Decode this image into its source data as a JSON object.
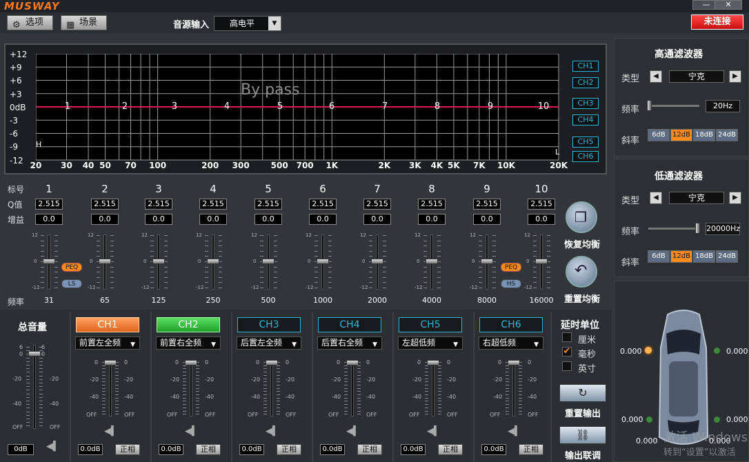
{
  "app": {
    "logo": "MUSWAY"
  },
  "window": {
    "minimize": "—",
    "close": "✕"
  },
  "toolbar": {
    "options_label": "选项",
    "scene_label": "场景",
    "source_label": "音源输入",
    "source_value": "高电平",
    "connection_label": "未连接"
  },
  "eq_graph": {
    "y_labels": [
      "+12",
      "+9",
      "+6",
      "+3",
      "0dB",
      "-3",
      "-6",
      "-9",
      "-12"
    ],
    "x_labels": [
      "20",
      "30",
      "40",
      "50",
      "70",
      "100",
      "200",
      "300",
      "500",
      "700",
      "1K",
      "2K",
      "3K",
      "4K",
      "5K",
      "7K",
      "10K",
      "20K"
    ],
    "bypass_text": "By pass",
    "band_markers": [
      "1",
      "2",
      "3",
      "4",
      "5",
      "6",
      "7",
      "8",
      "9",
      "10"
    ],
    "high_marker": "H",
    "low_marker": "L",
    "channel_buttons": [
      "CH1",
      "CH2",
      "CH3",
      "CH4",
      "CH5",
      "CH6"
    ]
  },
  "eq_bands": {
    "row_labels": {
      "index": "标号",
      "q": "Q值",
      "gain": "增益",
      "freq": "频率"
    },
    "scale": {
      "top": "12",
      "mid": "0",
      "bottom": "-12"
    },
    "bands": [
      {
        "id": "1",
        "q": "2.515",
        "gain": "0.0",
        "freq": "31",
        "level": 0
      },
      {
        "id": "2",
        "q": "2.515",
        "gain": "0.0",
        "freq": "65",
        "level": 0
      },
      {
        "id": "3",
        "q": "2.515",
        "gain": "0.0",
        "freq": "125",
        "level": 0
      },
      {
        "id": "4",
        "q": "2.515",
        "gain": "0.0",
        "freq": "250",
        "level": 0
      },
      {
        "id": "5",
        "q": "2.515",
        "gain": "0.0",
        "freq": "500",
        "level": 0
      },
      {
        "id": "6",
        "q": "2.515",
        "gain": "0.0",
        "freq": "1000",
        "level": 0
      },
      {
        "id": "7",
        "q": "2.515",
        "gain": "0.0",
        "freq": "2000",
        "level": 0
      },
      {
        "id": "8",
        "q": "2.515",
        "gain": "0.0",
        "freq": "4000",
        "level": 0
      },
      {
        "id": "9",
        "q": "2.515",
        "gain": "0.0",
        "freq": "8000",
        "level": 0
      },
      {
        "id": "10",
        "q": "2.515",
        "gain": "0.0",
        "freq": "16000",
        "level": 0
      }
    ],
    "band1_pills": {
      "peq": "PEQ",
      "shelf": "LS"
    },
    "band9_pills": {
      "peq": "PEQ",
      "shelf": "HS"
    },
    "restore_label": "恢复均衡",
    "reset_label": "重置均衡"
  },
  "colors": {
    "accent_orange": "#ff8a1a",
    "green": "#29c93a",
    "cyan": "#27b7d8",
    "connect_red": "#e81d1d",
    "curve": "#e3135a"
  },
  "highpass": {
    "title": "高通滤波器",
    "type_label": "类型",
    "type_value": "宁克",
    "freq_label": "频率",
    "freq_value": "20Hz",
    "slope_label": "斜率",
    "slopes": [
      "6dB",
      "12dB",
      "18dB",
      "24dB"
    ],
    "slope_selected": "12dB",
    "level": 0.0
  },
  "lowpass": {
    "title": "低通滤波器",
    "type_label": "类型",
    "type_value": "宁克",
    "freq_label": "频率",
    "freq_value": "20000Hz",
    "slope_label": "斜率",
    "slopes": [
      "6dB",
      "12dB",
      "18dB",
      "24dB"
    ],
    "slope_selected": "12dB",
    "level": 1.0
  },
  "master": {
    "title": "总音量",
    "scale": [
      "6",
      "0",
      "-20",
      "-40",
      "OFF"
    ],
    "value": "0dB"
  },
  "channels": [
    {
      "name": "CH1",
      "state": "orange",
      "position": "前置左全频",
      "db": "0.0dB",
      "phase": "正相"
    },
    {
      "name": "CH2",
      "state": "green",
      "position": "前置右全频",
      "db": "0.0dB",
      "phase": "正相"
    },
    {
      "name": "CH3",
      "state": "outline",
      "position": "后置左全频",
      "db": "0.0dB",
      "phase": "正相"
    },
    {
      "name": "CH4",
      "state": "outline",
      "position": "后置右全频",
      "db": "0.0dB",
      "phase": "正相"
    },
    {
      "name": "CH5",
      "state": "outline",
      "position": "左超低频",
      "db": "0.0dB",
      "phase": "正相"
    },
    {
      "name": "CH6",
      "state": "outline",
      "position": "右超低频",
      "db": "0.0dB",
      "phase": "正相"
    }
  ],
  "channel_scale": [
    "0",
    "-20",
    "-40",
    "OFF"
  ],
  "delay": {
    "title": "延时单位",
    "options": [
      {
        "label": "厘米",
        "checked": false
      },
      {
        "label": "毫秒",
        "checked": true
      },
      {
        "label": "英寸",
        "checked": false
      }
    ]
  },
  "output": {
    "reset_label": "重置输出",
    "link_label": "输出联调"
  },
  "car": {
    "values": [
      "0.000",
      "0.000",
      "0.000",
      "0.000",
      "0.000",
      "0.000"
    ]
  },
  "watermark": {
    "line1": "激活 Windows",
    "line2": "转到“设置”以激活"
  }
}
